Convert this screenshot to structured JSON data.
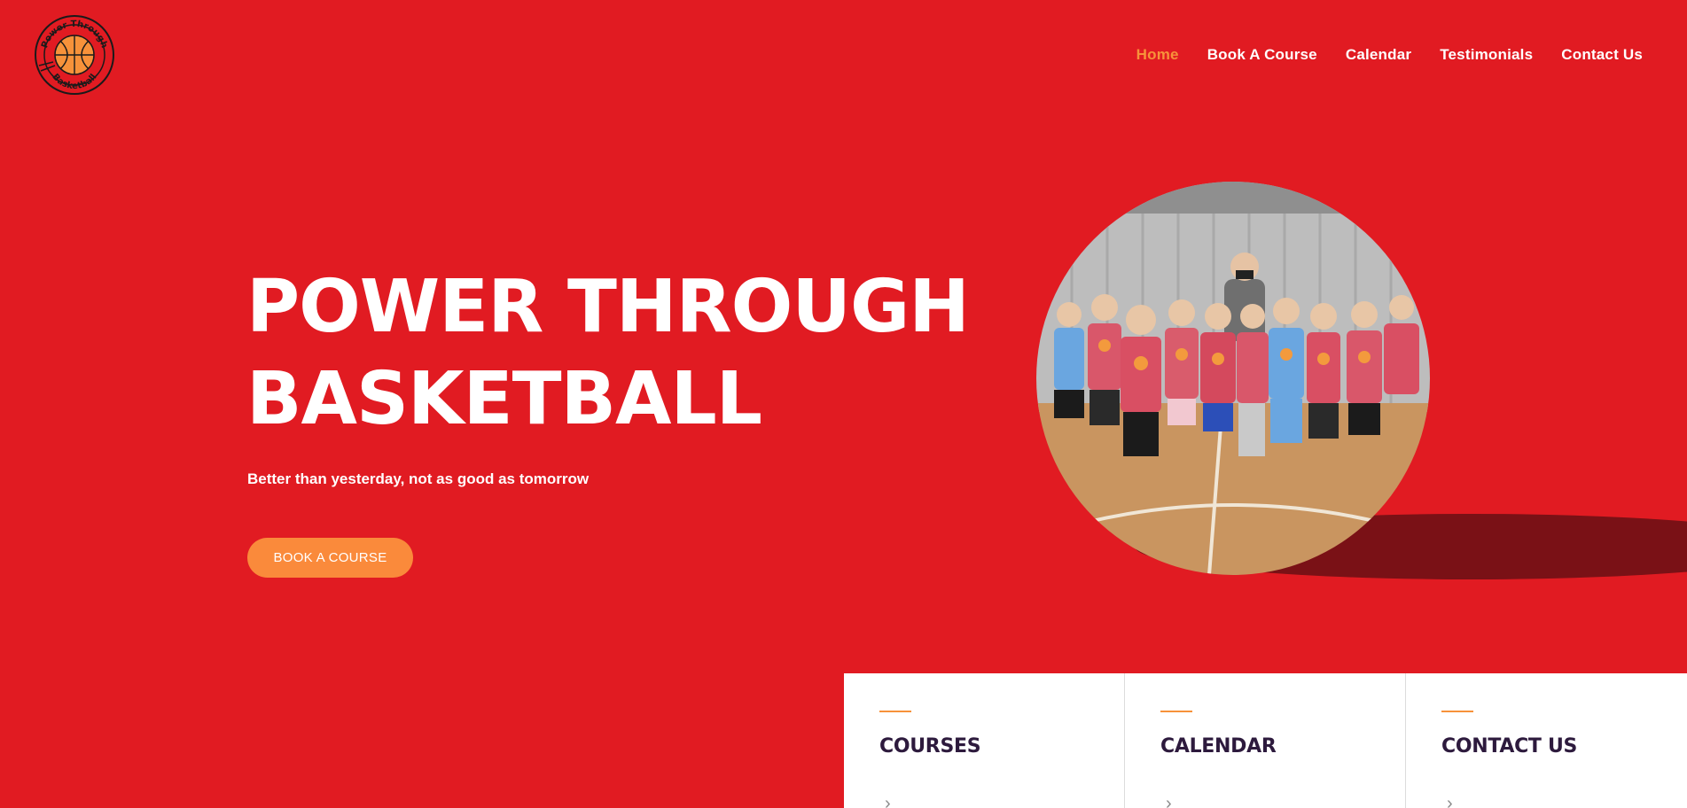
{
  "logo": {
    "text_top": "Power Through",
    "text_bottom": "Basketball"
  },
  "nav": {
    "items": [
      {
        "label": "Home",
        "active": true
      },
      {
        "label": "Book A Course",
        "active": false
      },
      {
        "label": "Calendar",
        "active": false
      },
      {
        "label": "Testimonials",
        "active": false
      },
      {
        "label": "Contact Us",
        "active": false
      }
    ]
  },
  "hero": {
    "title_line1": "POWER THROUGH",
    "title_line2": "BASKETBALL",
    "tagline": "Better than yesterday, not as good as tomorrow",
    "cta_label": "BOOK A COURSE"
  },
  "cards": [
    {
      "title": "COURSES",
      "arrow": "›"
    },
    {
      "title": "CALENDAR",
      "arrow": "›"
    },
    {
      "title": "CONTACT US",
      "arrow": "›"
    }
  ],
  "colors": {
    "background": "#e11b22",
    "accent": "#fa8a3b",
    "heading_dark": "#2d1a3d"
  }
}
